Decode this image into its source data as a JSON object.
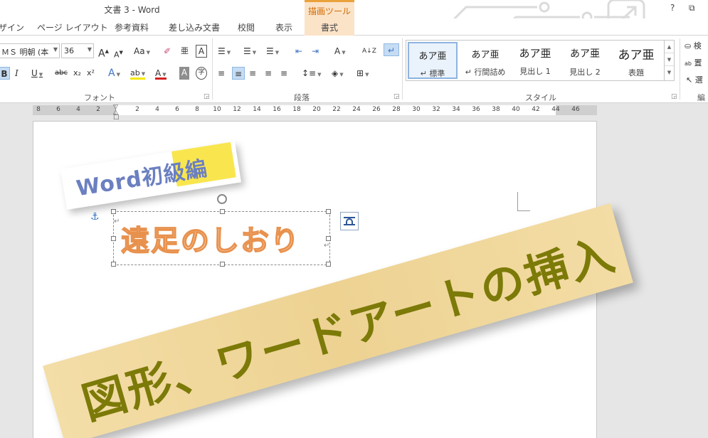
{
  "window": {
    "title": "文書 3 - Word",
    "help": "?",
    "restore": "⧉"
  },
  "context_tab": {
    "header": "描画ツール",
    "tab": "書式"
  },
  "tabs": [
    "ザイン",
    "ページ レイアウト",
    "参考資料",
    "差し込み文書",
    "校閲",
    "表示"
  ],
  "font_group": {
    "font_name": "ＭＳ 明朝 (本",
    "font_size": "36",
    "grow": "A",
    "shrink": "A",
    "case": "Aa",
    "clear": "✐",
    "phonetic": "亜",
    "border_char": "A",
    "bold": "B",
    "italic": "I",
    "underline": "U",
    "strike": "abc",
    "subscript": "x₂",
    "superscript": "x²",
    "effects": "A",
    "highlight": "ab",
    "font_color": "A",
    "shading": "A",
    "enclose": "字",
    "label": "フォント"
  },
  "paragraph_group": {
    "bullets": "☰",
    "numbering": "☰",
    "multilevel": "☰",
    "decrease_indent": "⇤",
    "increase_indent": "⇥",
    "asian_layout": "A",
    "sort": "A↓Z",
    "show_marks": "↵",
    "align_left": "≡",
    "align_center": "≡",
    "align_right": "≡",
    "justify": "≡",
    "distribute": "≡",
    "line_spacing": "↕≡",
    "shading": "◈",
    "borders": "⊞",
    "label": "段落"
  },
  "styles_group": {
    "items": [
      {
        "preview": "あア亜",
        "name": "↵ 標準",
        "selected": true
      },
      {
        "preview": "あア亜",
        "name": "↵ 行間詰め",
        "selected": false
      },
      {
        "preview": "あア亜",
        "name": "見出し 1",
        "selected": false
      },
      {
        "preview": "あア亜",
        "name": "見出し 2",
        "selected": false
      },
      {
        "preview": "あア亜",
        "name": "表題",
        "selected": false
      }
    ],
    "label": "スタイル"
  },
  "editing_group": {
    "find": "検",
    "replace": "置",
    "select": "選",
    "label": "編"
  },
  "ruler": {
    "ticks": [
      "8",
      "6",
      "4",
      "2",
      "2",
      "4",
      "6",
      "8",
      "10",
      "12",
      "14",
      "16",
      "18",
      "20",
      "22",
      "24",
      "26",
      "28",
      "30",
      "32",
      "34",
      "36",
      "38",
      "40",
      "42",
      "44",
      "46"
    ]
  },
  "document": {
    "wordart_text": "遠足のしおり",
    "note_small": "Word初級編",
    "note_big": "図形、ワードアートの挿入"
  },
  "colors": {
    "accent_tab": "#d16a00",
    "wordart_outline": "#e8914d",
    "note_small_text": "#6b7fc1",
    "note_small_highlight": "#f9e64f",
    "note_big_text": "#7c7a08",
    "note_big_bg": "#f2d99b"
  }
}
